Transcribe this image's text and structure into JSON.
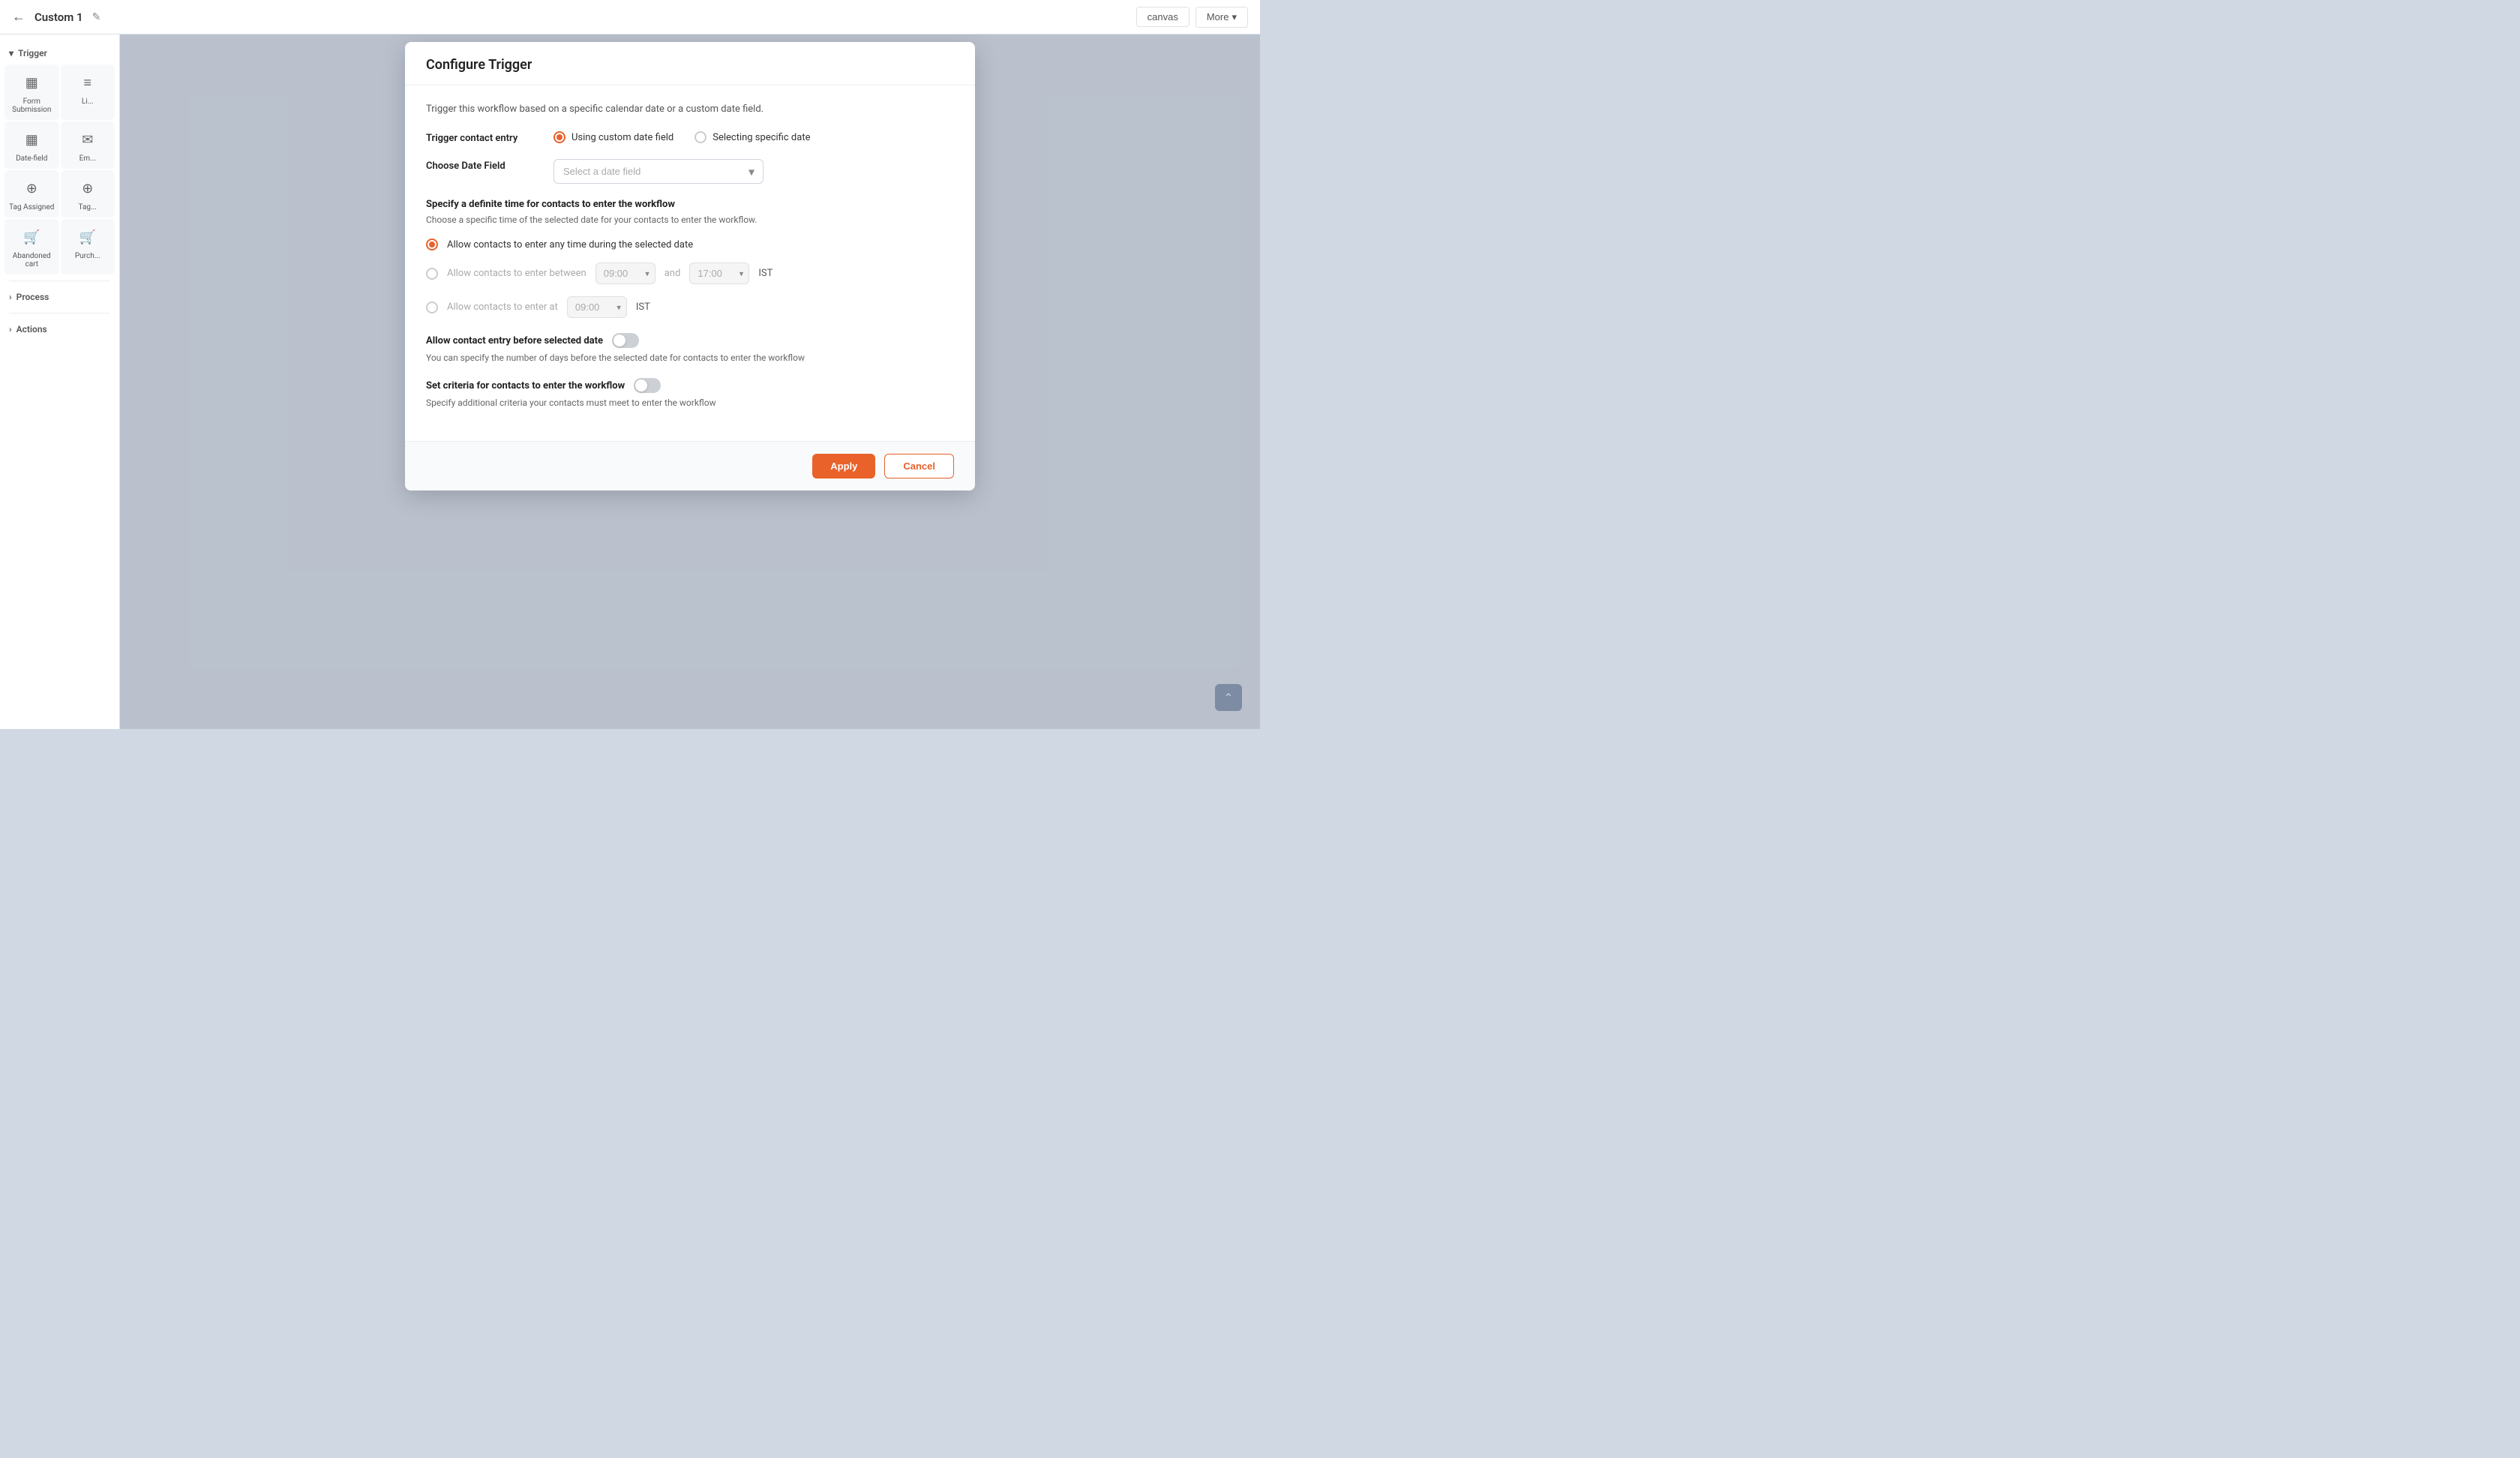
{
  "topbar": {
    "back_icon": "←",
    "title": "Custom 1",
    "edit_icon": "✎",
    "canvas_btn": "canvas",
    "more_btn": "More",
    "chevron_down": "▾"
  },
  "sidebar": {
    "trigger_label": "Trigger",
    "trigger_chevron": "▾",
    "items": [
      {
        "id": "form-submission",
        "label": "Form Submission",
        "icon": "▦"
      },
      {
        "id": "list",
        "label": "Li...",
        "icon": "≡"
      },
      {
        "id": "date-field",
        "label": "Date-field",
        "icon": "▦"
      },
      {
        "id": "email",
        "label": "Em...",
        "icon": "✉"
      },
      {
        "id": "tag-assigned",
        "label": "Tag Assigned",
        "icon": "⊕"
      },
      {
        "id": "tag2",
        "label": "Tag...",
        "icon": "⊕"
      },
      {
        "id": "abandoned-cart",
        "label": "Abandoned cart",
        "icon": "🛒"
      },
      {
        "id": "purchase",
        "label": "Purch...",
        "icon": "🛒"
      }
    ],
    "process_label": "Process",
    "process_chevron": "›",
    "actions_label": "Actions",
    "actions_chevron": "›"
  },
  "modal": {
    "title": "Configure Trigger",
    "intro": "Trigger this workflow based on a specific calendar date or a custom date field.",
    "trigger_contact_entry_label": "Trigger contact entry",
    "radio_option1": "Using custom date field",
    "radio_option2": "Selecting specific date",
    "radio1_active": true,
    "radio2_active": false,
    "choose_date_field_label": "Choose Date Field",
    "date_field_placeholder": "Select a date field",
    "specify_time_title": "Specify a definite time for contacts to enter the workflow",
    "specify_time_subtitle": "Choose a specific time of the selected date for your contacts to enter the workflow.",
    "radio_any_time": "Allow contacts to enter any time during the selected date",
    "radio_any_time_active": true,
    "radio_between": "Allow contacts to enter between",
    "radio_between_active": false,
    "time_start": "09:00",
    "and_label": "and",
    "time_end": "17:00",
    "timezone1": "IST",
    "radio_at": "Allow contacts to enter at",
    "radio_at_active": false,
    "time_at": "09:00",
    "timezone2": "IST",
    "allow_before_label": "Allow contact entry before selected date",
    "allow_before_desc": "You can specify the number of days before the selected date for contacts to enter the workflow",
    "allow_before_on": false,
    "criteria_label": "Set criteria for contacts to enter the workflow",
    "criteria_desc": "Specify additional criteria your contacts must meet to enter the workflow",
    "criteria_on": false,
    "apply_btn": "Apply",
    "cancel_btn": "Cancel"
  },
  "scroll_top_icon": "⌃"
}
